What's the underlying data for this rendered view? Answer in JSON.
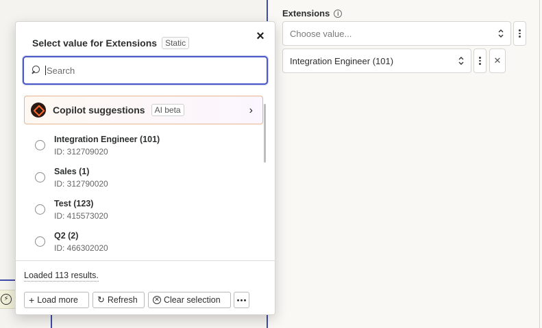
{
  "field": {
    "label": "Extensions",
    "placeholder": "Choose value...",
    "selected_value": "Integration Engineer (101)"
  },
  "popup": {
    "title": "Select value for Extensions",
    "badge": "Static",
    "search_placeholder": "Search",
    "copilot": {
      "label": "Copilot suggestions",
      "badge": "AI beta"
    },
    "options": [
      {
        "label": "Integration Engineer (101)",
        "id": "ID: 312709020"
      },
      {
        "label": "Sales (1)",
        "id": "ID: 312790020"
      },
      {
        "label": "Test (123)",
        "id": "ID: 415573020"
      },
      {
        "label": "Q2 (2)",
        "id": "ID: 466302020"
      }
    ],
    "status": "Loaded 113 results.",
    "buttons": {
      "load_more": "Load more",
      "refresh": "Refresh",
      "clear_selection": "Clear selection"
    }
  },
  "colors": {
    "accent": "#4a58c8",
    "canvas_line": "#3d4aa8",
    "copilot_border": "#e6b38e"
  }
}
